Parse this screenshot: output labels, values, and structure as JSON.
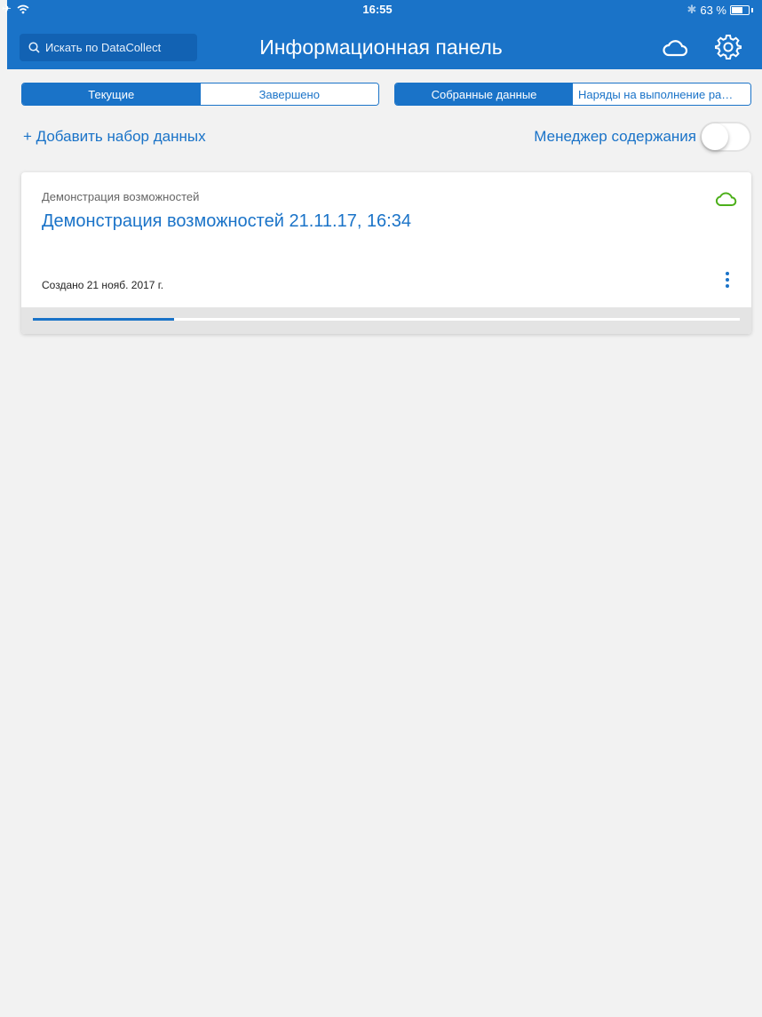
{
  "status_bar": {
    "time": "16:55",
    "battery": "63 %"
  },
  "header": {
    "search_placeholder": "Искать по DataCollect",
    "title": "Информационная панель",
    "icons": [
      "cloud-icon",
      "gear-icon",
      "search-icon"
    ]
  },
  "segments": {
    "left": [
      "Текущие",
      "Завершено"
    ],
    "left_selected": 0,
    "right": [
      "Собранные данные",
      "Наряды на выполнение ра…"
    ],
    "right_selected": 0
  },
  "actions": {
    "add_dataset": "+ Добавить набор данных",
    "content_manager": "Менеджер содержания",
    "content_manager_on": false
  },
  "card": {
    "subtitle": "Демонстрация возможностей",
    "title": "Демонстрация возможностей 21.11.17, 16:34",
    "created": "Создано 21 нояб. 2017 г.",
    "progress": 0.2,
    "cloud_color": "#4caf1a"
  },
  "colors": {
    "accent": "#1a73c8",
    "background": "#f2f2f2"
  }
}
